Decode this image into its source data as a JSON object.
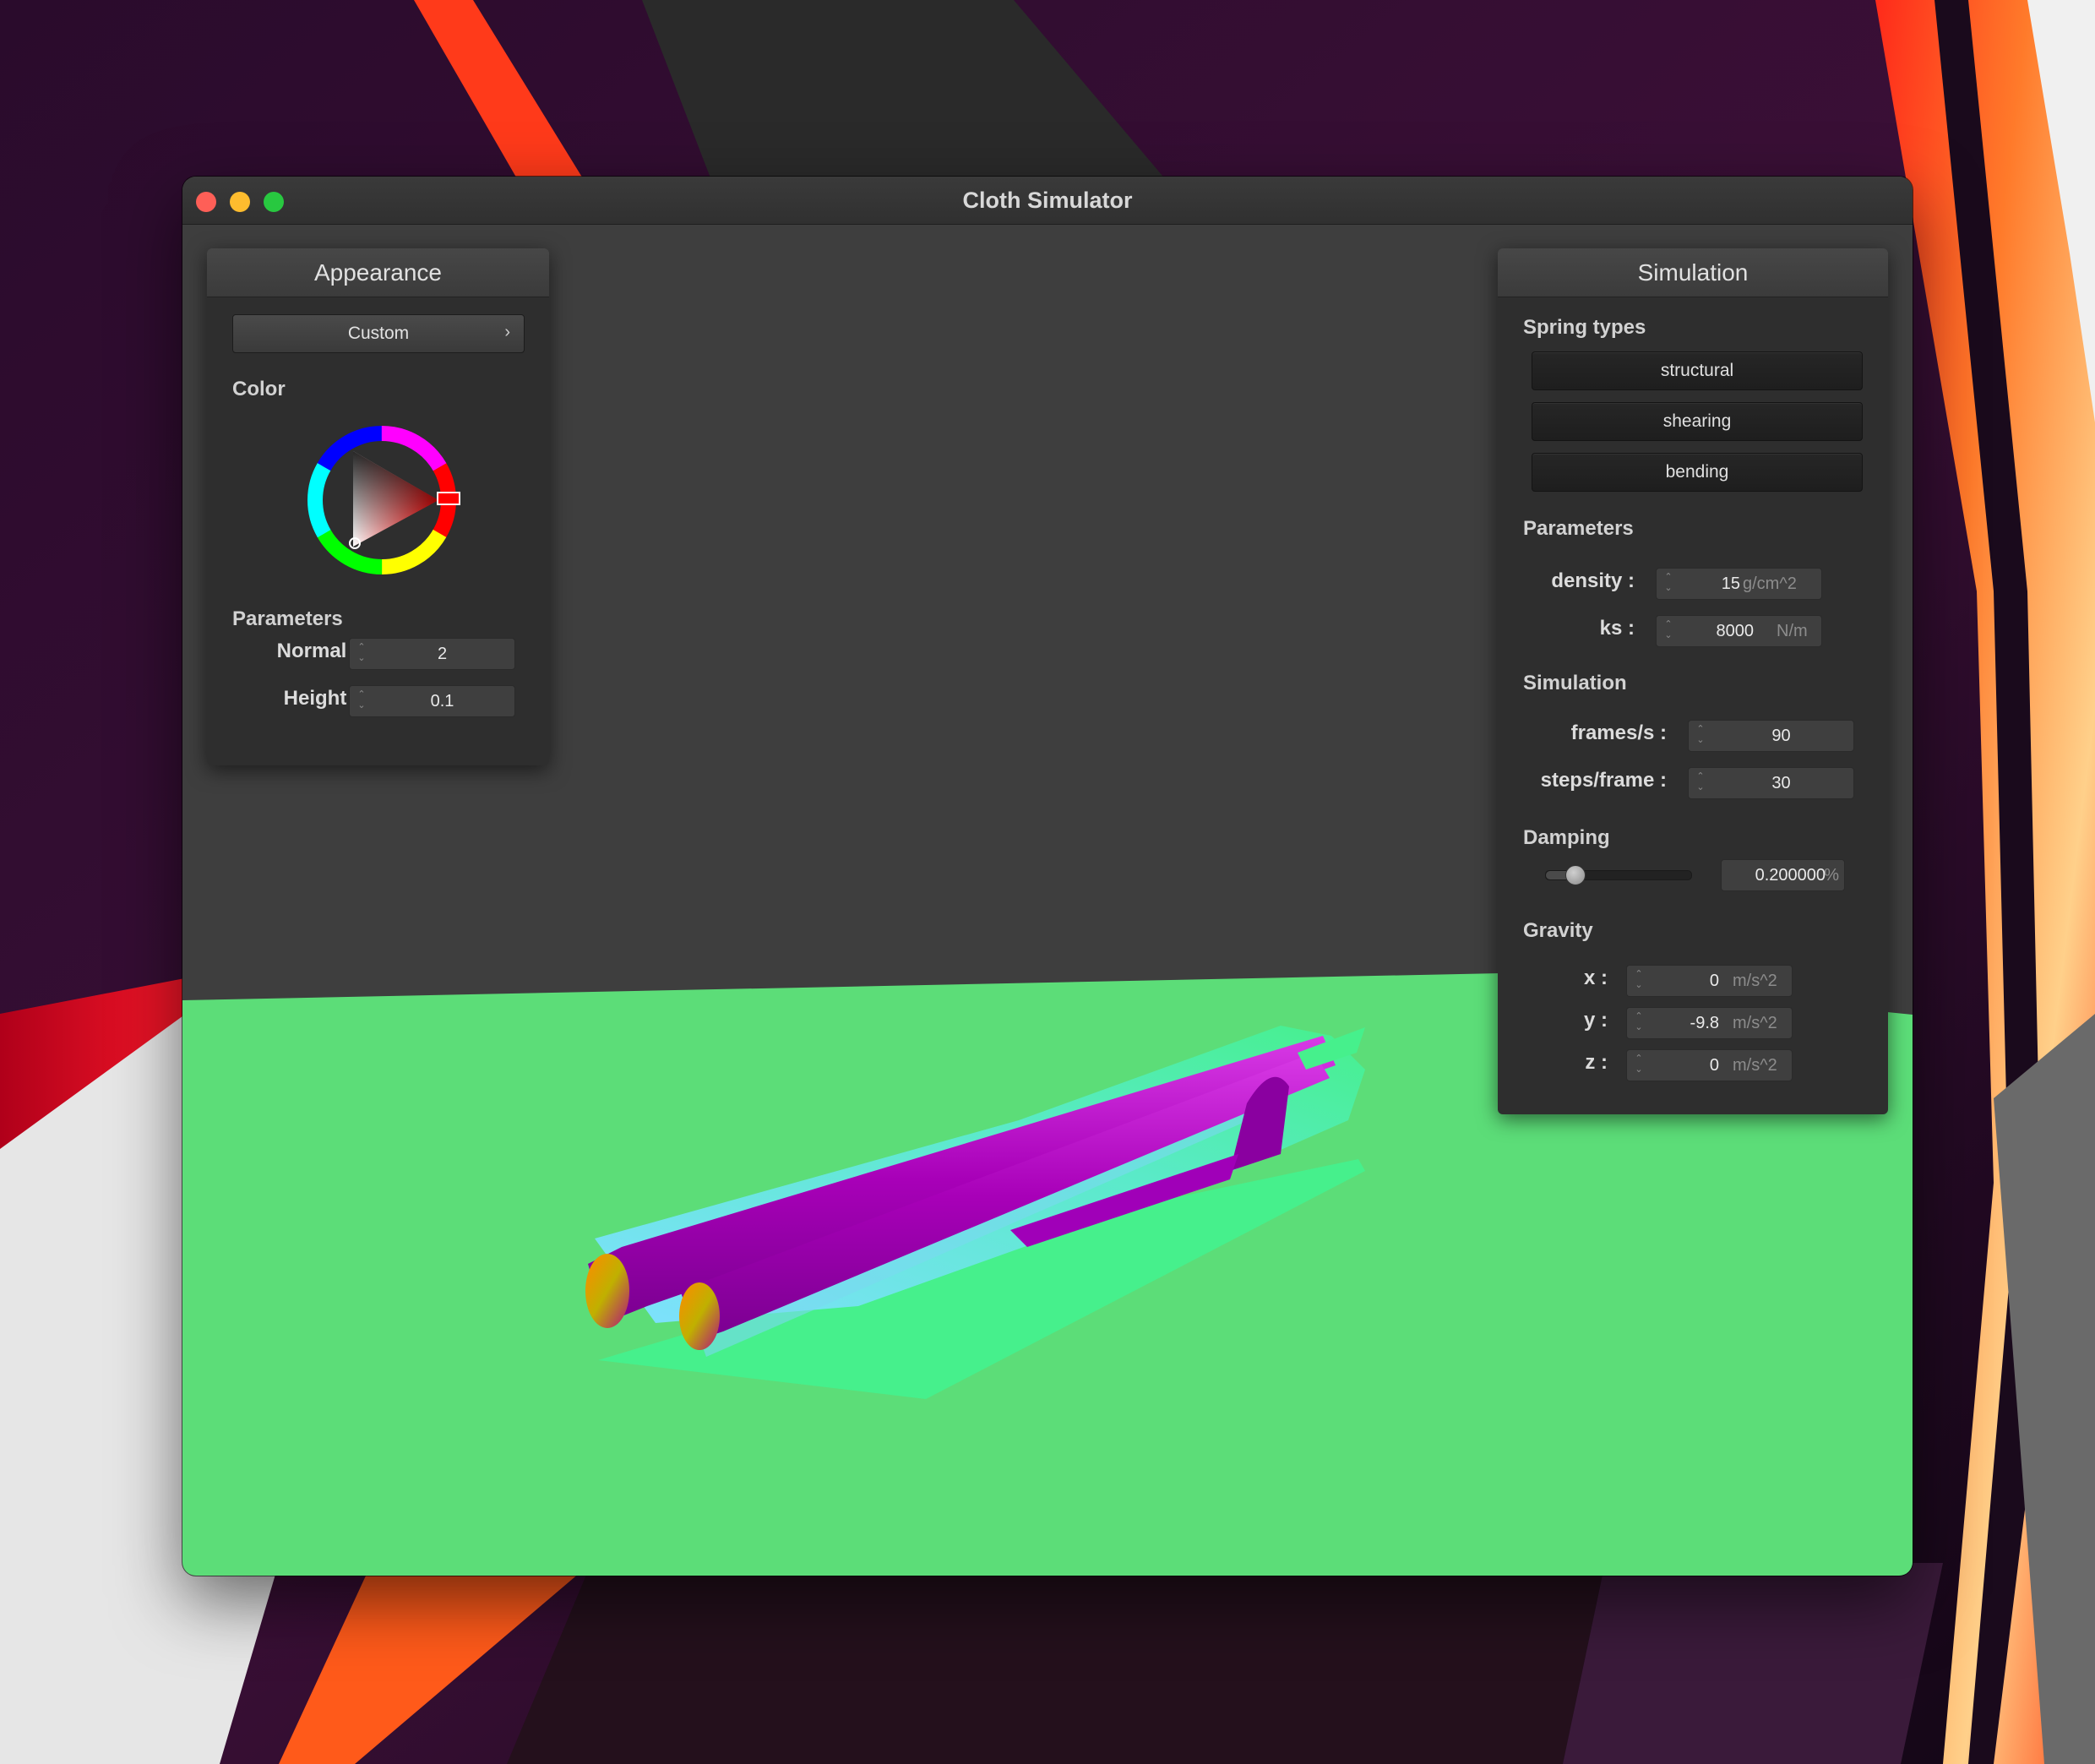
{
  "window": {
    "title": "Cloth Simulator"
  },
  "colors": {
    "accent_red": "#ff0000",
    "ground": "#5cdd78",
    "panel_bg": "#2e2e2e",
    "viewport_bg": "#3e3e3e"
  },
  "appearance": {
    "header": "Appearance",
    "preset": "Custom",
    "preset_icon": "chevron-right-icon",
    "color_label": "Color",
    "selected_color": "#ff0000",
    "parameters_label": "Parameters",
    "normal": {
      "label": "Normal :",
      "value": "2"
    },
    "height": {
      "label": "Height :",
      "value": "0.1"
    }
  },
  "simulation": {
    "header": "Simulation",
    "spring_types_label": "Spring types",
    "spring_types": [
      "structural",
      "shearing",
      "bending"
    ],
    "parameters_label": "Parameters",
    "density": {
      "label": "density :",
      "value": "15",
      "unit": "g/cm^2"
    },
    "ks": {
      "label": "ks :",
      "value": "8000",
      "unit": "N/m"
    },
    "simulation_label": "Simulation",
    "frames_per_s": {
      "label": "frames/s :",
      "value": "90"
    },
    "steps_per_frame": {
      "label": "steps/frame :",
      "value": "30"
    },
    "damping_label": "Damping",
    "damping": {
      "value": "0.200000",
      "unit": "%",
      "level": 0.2
    },
    "gravity_label": "Gravity",
    "gravity": {
      "x": {
        "label": "x :",
        "value": "0",
        "unit": "m/s^2"
      },
      "y": {
        "label": "y :",
        "value": "-9.8",
        "unit": "m/s^2"
      },
      "z": {
        "label": "z :",
        "value": "0",
        "unit": "m/s^2"
      }
    }
  }
}
